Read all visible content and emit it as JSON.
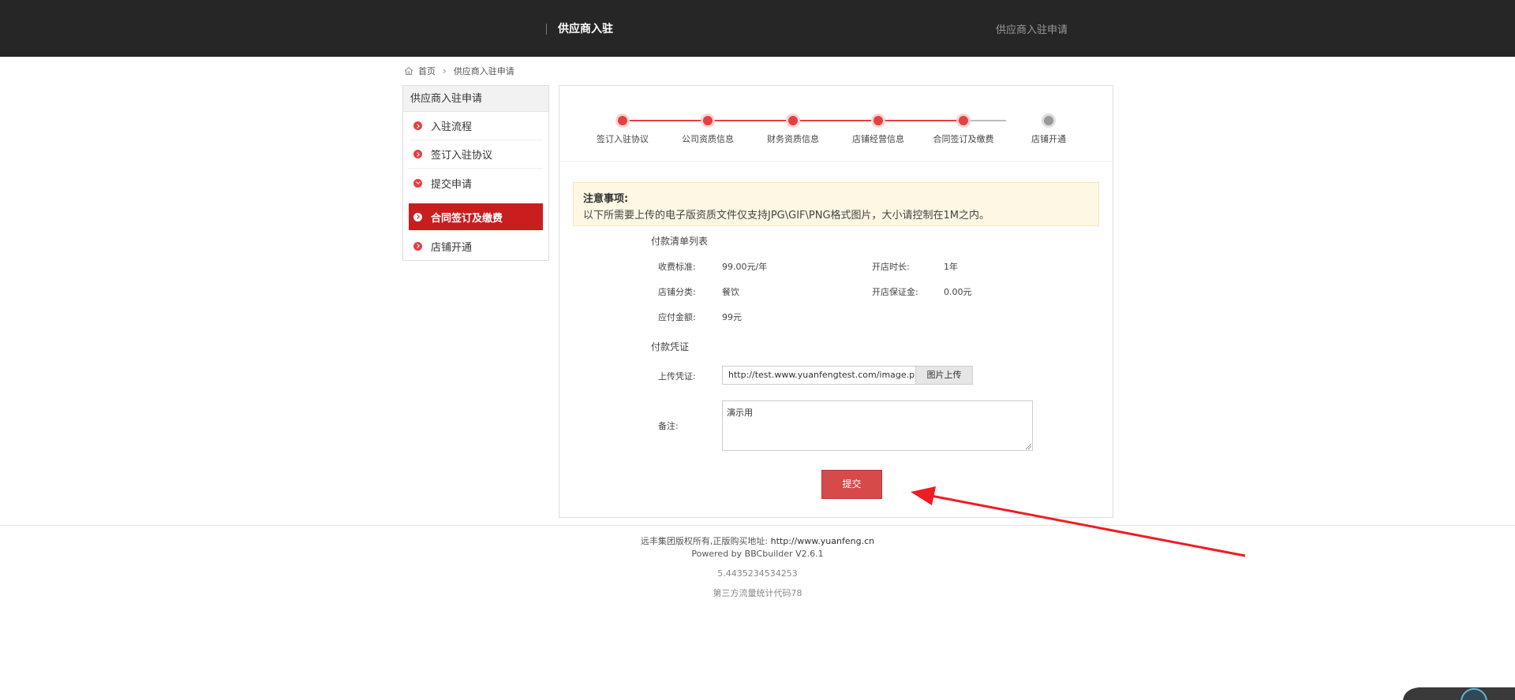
{
  "header": {
    "title": "供应商入驻",
    "right_link": "供应商入驻申请"
  },
  "breadcrumb": {
    "home": "首页",
    "current": "供应商入驻申请"
  },
  "sidebar": {
    "heading": "供应商入驻申请",
    "items": [
      {
        "label": "入驻流程"
      },
      {
        "label": "签订入驻协议"
      },
      {
        "label": "提交申请"
      },
      {
        "label": "合同签订及缴费"
      },
      {
        "label": "店铺开通"
      }
    ]
  },
  "steps": [
    {
      "label": "签订入驻协议",
      "done": true
    },
    {
      "label": "公司资质信息",
      "done": true
    },
    {
      "label": "财务资质信息",
      "done": true
    },
    {
      "label": "店铺经营信息",
      "done": true
    },
    {
      "label": "合同签订及缴费",
      "done": true
    },
    {
      "label": "店铺开通",
      "done": false
    }
  ],
  "notice": {
    "title": "注意事项:",
    "text": "以下所需要上传的电子版资质文件仅支持JPG\\GIF\\PNG格式图片，大小请控制在1M之内。"
  },
  "payment_list": {
    "title": "付款清单列表",
    "fee_label": "收费标准:",
    "fee_value": "99.00元/年",
    "duration_label": "开店时长:",
    "duration_value": "1年",
    "category_label": "店铺分类:",
    "category_value": "餐饮",
    "deposit_label": "开店保证金:",
    "deposit_value": "0.00元",
    "amount_label": "应付金额:",
    "amount_value": "99元"
  },
  "voucher": {
    "title": "付款凭证",
    "upload_label": "上传凭证:",
    "upload_value": "http://test.www.yuanfengtest.com/image.ph",
    "upload_button": "图片上传",
    "remark_label": "备注:",
    "remark_value": "演示用"
  },
  "submit_label": "提交",
  "footer": {
    "copyright": "远丰集团版权所有,正版购买地址:",
    "link": "http://www.yuanfeng.cn",
    "powered": "Powered by BBCbuilder V2.6.1",
    "number": "5.4435234534253",
    "stats": "第三方流量统计代码78"
  },
  "colors": {
    "accent": "#c81e1e",
    "step": "#e54040",
    "header_bg": "#262626",
    "notice_bg": "#fdf7e3",
    "annotation_arrow": "#ee1c24"
  }
}
